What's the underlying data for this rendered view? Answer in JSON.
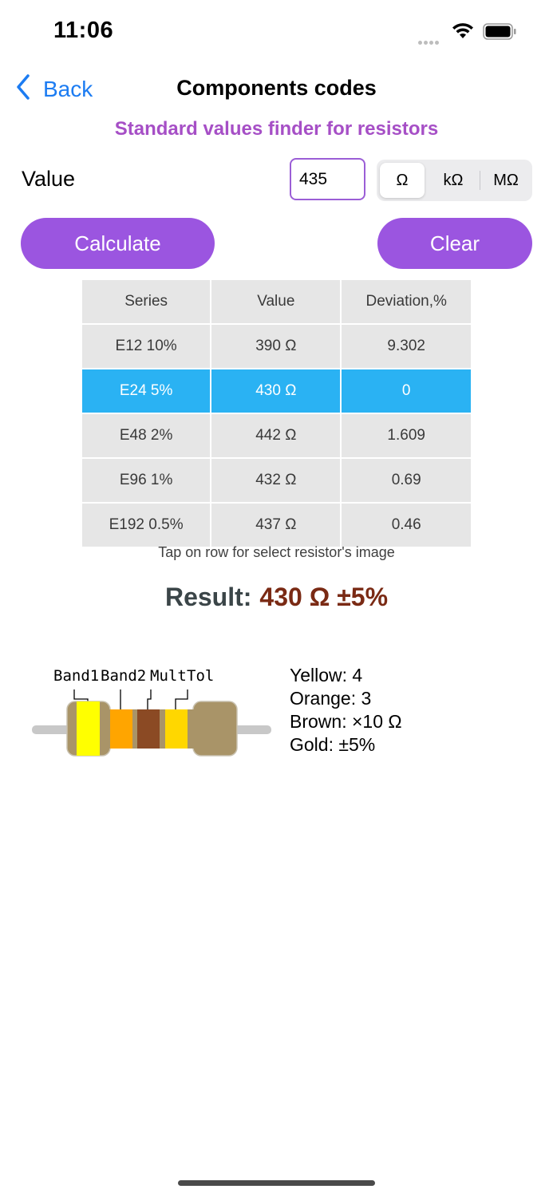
{
  "status_bar": {
    "time": "11:06"
  },
  "nav": {
    "back_label": "Back",
    "title": "Components codes"
  },
  "subtitle": "Standard values finder for resistors",
  "input": {
    "label": "Value",
    "value": "435"
  },
  "units": {
    "options": [
      "Ω",
      "kΩ",
      "MΩ"
    ],
    "selected": "Ω"
  },
  "buttons": {
    "calculate": "Calculate",
    "clear": "Clear"
  },
  "table": {
    "headers": [
      "Series",
      "Value",
      "Deviation,%"
    ],
    "rows": [
      [
        "E12 10%",
        "390 Ω",
        "9.302"
      ],
      [
        "E24 5%",
        "430 Ω",
        "0"
      ],
      [
        "E48 2%",
        "442 Ω",
        "1.609"
      ],
      [
        "E96 1%",
        "432 Ω",
        "0.69"
      ],
      [
        "E192 0.5%",
        "437 Ω",
        "0.46"
      ]
    ],
    "selected_row": 1
  },
  "hint": "Tap on row for select resistor's image",
  "result": {
    "label": "Result:",
    "value": "430 Ω ±5%"
  },
  "bands": {
    "labels": [
      "Band1",
      "Band2",
      "Mult",
      "Tol"
    ],
    "colors": {
      "band1": "#ffff00",
      "band2": "#ffa500",
      "mult": "#8b4a24",
      "tol": "#ffd700",
      "body": "#a99468",
      "lead": "#c8c8c8"
    }
  },
  "decode": [
    "Yellow: 4",
    "Orange: 3",
    "Brown: ×10 Ω",
    "Gold: ±5%"
  ]
}
